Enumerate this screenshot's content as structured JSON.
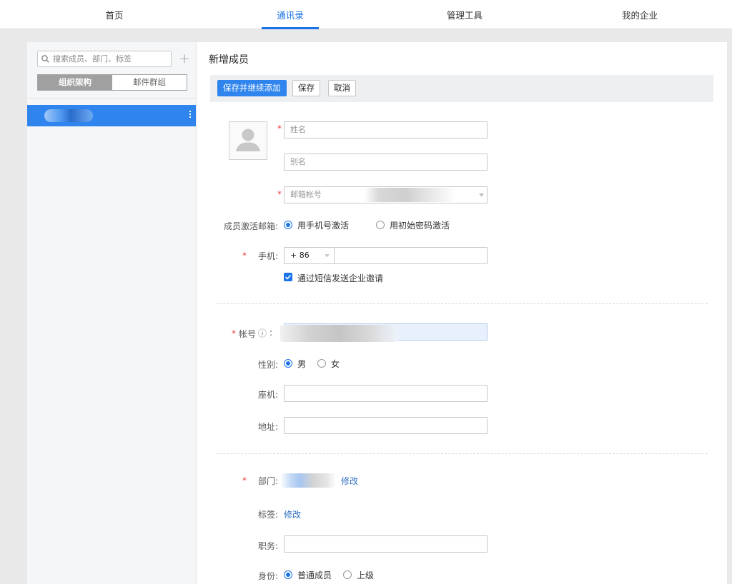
{
  "top_nav": {
    "tabs": [
      {
        "label": "首页",
        "active": false
      },
      {
        "label": "通讯录",
        "active": true
      },
      {
        "label": "管理工具",
        "active": false
      },
      {
        "label": "我的企业",
        "active": false
      }
    ]
  },
  "sidebar": {
    "search_placeholder": "搜索成员、部门、标签",
    "add_symbol": "+",
    "segments": [
      "组织架构",
      "邮件群组"
    ],
    "active_segment": "组织架构"
  },
  "form": {
    "title": "新增成员",
    "toolbar": {
      "save_continue": "保存并继续添加",
      "save": "保存",
      "cancel": "取消"
    },
    "required_mark": "*",
    "name_placeholder": "姓名",
    "alias_placeholder": "别名",
    "email_placeholder": "邮箱帐号",
    "activation": {
      "label": "成员激活邮箱:",
      "options": [
        "用手机号激活",
        "用初始密码激活"
      ],
      "selected": "用手机号激活"
    },
    "phone": {
      "label": "手机:",
      "country_code": "+ 86",
      "sms_invite_label": "通过短信发送企业邀请",
      "sms_invite_checked": true
    },
    "account": {
      "label": "帐号",
      "info_icon": "ⓘ",
      "colon": ":"
    },
    "gender": {
      "label": "性别:",
      "options": [
        "男",
        "女"
      ],
      "selected": "男"
    },
    "landline": {
      "label": "座机:"
    },
    "address": {
      "label": "地址:"
    },
    "department": {
      "label": "部门:",
      "edit_link": "修改"
    },
    "tags": {
      "label": "标签:",
      "edit_link": "修改"
    },
    "position": {
      "label": "职务:"
    },
    "identity": {
      "label": "身份:",
      "options": [
        "普通成员",
        "上级"
      ],
      "selected": "普通成员"
    }
  },
  "colors": {
    "accent": "#1a73e8",
    "primary_button": "#2f85ed",
    "required": "#e64340",
    "link": "#2f6ec2"
  },
  "icons": [
    "search-icon",
    "plus-icon",
    "more-vertical-icon",
    "avatar-placeholder-icon",
    "chevron-down-icon",
    "info-icon",
    "checkbox-checked-icon"
  ]
}
